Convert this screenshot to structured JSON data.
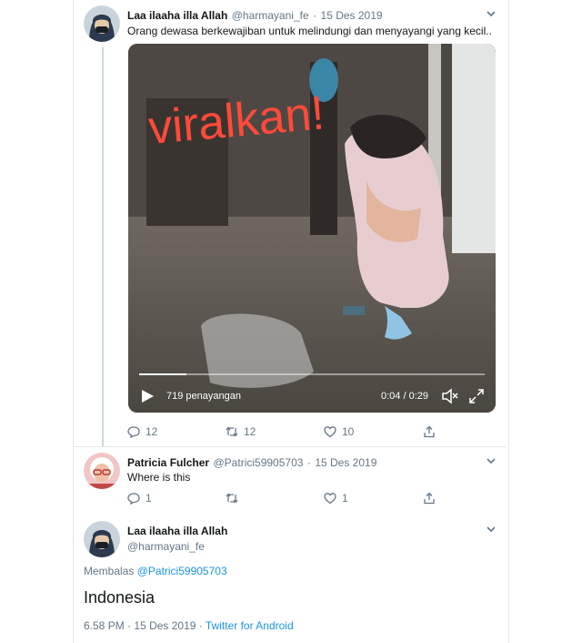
{
  "tweet1": {
    "name": "Laa ilaaha illa Allah",
    "handle": "@harmayani_fe",
    "dot": "·",
    "date": "15 Des 2019",
    "text": "Orang dewasa berkewajiban untuk melindungi dan menyayangi yang kecil..",
    "video": {
      "overlay_text": "viralkan!",
      "views": "719 penayangan",
      "time": "0:04 / 0:29",
      "progress": 0.138
    },
    "actions": {
      "replies": "12",
      "retweets": "12",
      "likes": "10"
    }
  },
  "tweet2": {
    "name": "Patricia Fulcher",
    "handle": "@Patrici59905703",
    "dot": "·",
    "date": "15 Des 2019",
    "text": "Where is this",
    "actions": {
      "replies": "1",
      "likes": "1"
    }
  },
  "tweet3": {
    "name": "Laa ilaaha illa Allah",
    "handle": "@harmayani_fe",
    "replying_prefix": "Membalas",
    "replying_to": "@Patrici59905703",
    "text": "Indonesia",
    "time": "6.58 PM",
    "dot": "·",
    "date": "15 Des 2019",
    "dot2": "·",
    "source": "Twitter for Android"
  },
  "icons": [
    "reply-icon",
    "retweet-icon",
    "like-icon",
    "share-icon",
    "caret-down-icon",
    "play-icon",
    "volume-icon",
    "fullscreen-icon"
  ],
  "colors": {
    "link": "#1b95e0",
    "muted": "#657786",
    "text": "#14171a",
    "overlay": "#ff4a3a"
  }
}
